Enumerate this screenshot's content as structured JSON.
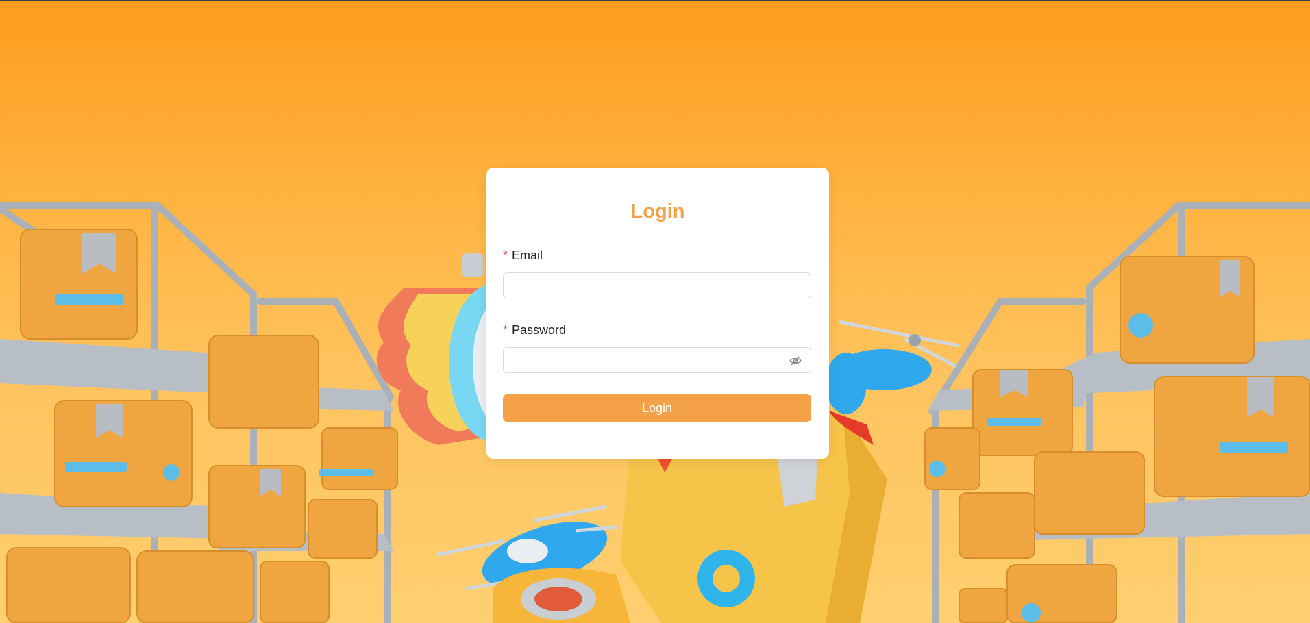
{
  "login": {
    "title": "Login",
    "email": {
      "required_mark": "*",
      "label": "Email",
      "value": "",
      "placeholder": ""
    },
    "password": {
      "required_mark": "*",
      "label": "Password",
      "value": "",
      "placeholder": "",
      "icon": "eye-slash-icon"
    },
    "submit_label": "Login"
  },
  "colors": {
    "accent": "#f5a148",
    "required": "#ff4d4f",
    "background_top": "#ff9c1e",
    "background_bottom": "#ffcf70"
  }
}
